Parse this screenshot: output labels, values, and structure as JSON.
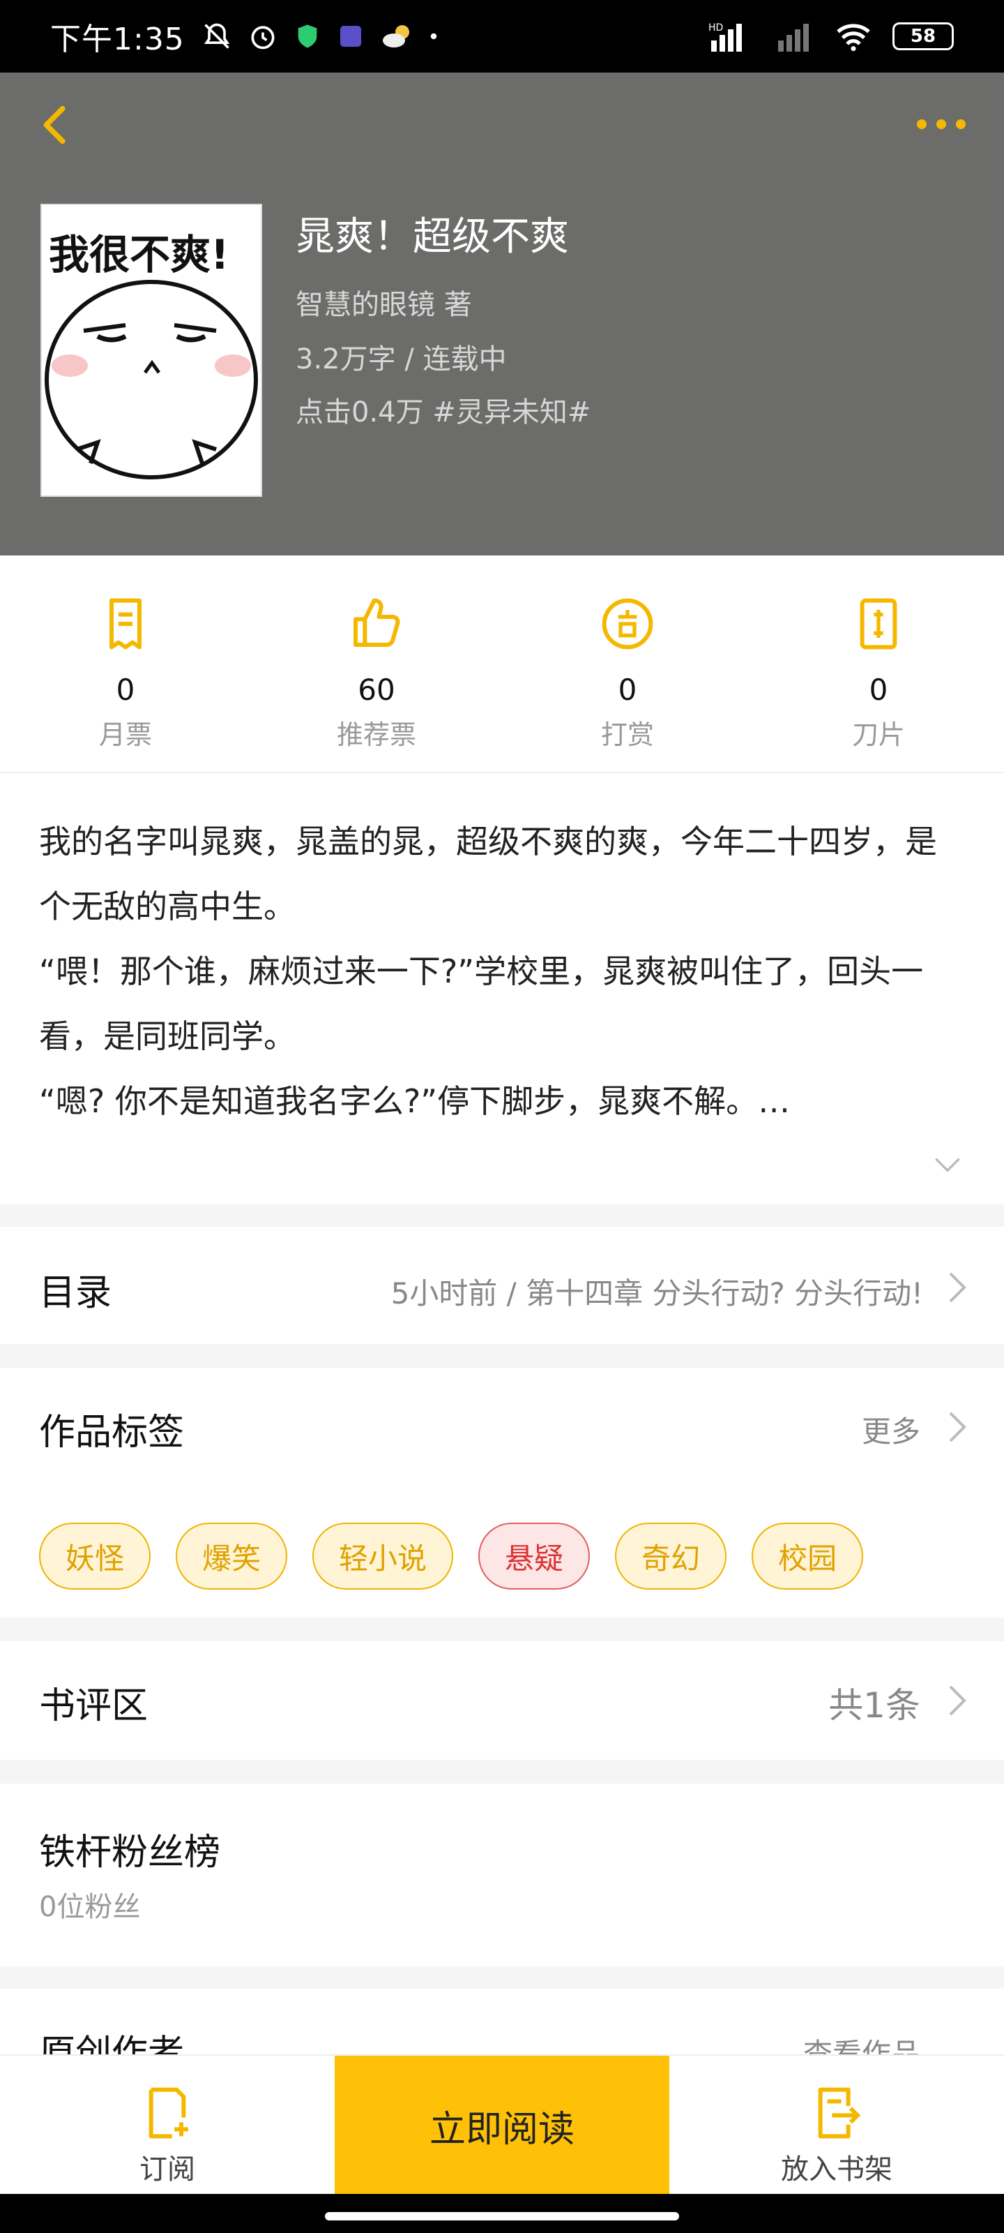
{
  "status_bar": {
    "time": "下午1:35",
    "battery": "58",
    "network_label": "HD"
  },
  "header": {
    "accent_color": "#f5b800"
  },
  "book": {
    "cover_text": "我很不爽!",
    "title": "晁爽！超级不爽",
    "author": "智慧的眼镜  著",
    "words_status": "3.2万字 / 连载中",
    "clicks_tag": "点击0.4万  #灵异未知#"
  },
  "stats": [
    {
      "icon": "monthly-ticket-icon",
      "value": "0",
      "label": "月票"
    },
    {
      "icon": "thumbs-up-icon",
      "value": "60",
      "label": "推荐票"
    },
    {
      "icon": "reward-icon",
      "value": "0",
      "label": "打赏"
    },
    {
      "icon": "blade-card-icon",
      "value": "0",
      "label": "刀片"
    }
  ],
  "intro": {
    "paragraphs": [
      "我的名字叫晁爽，晁盖的晁，超级不爽的爽，今年二十四岁，是个无敌的高中生。",
      "“喂！那个谁，麻烦过来一下?”学校里，晁爽被叫住了，回头一看，是同班同学。",
      "“嗯? 你不是知道我名字么?”停下脚步，晁爽不解。…"
    ]
  },
  "catalog": {
    "title": "目录",
    "latest": "5小时前 / 第十四章 分头行动? 分头行动!"
  },
  "tags_section": {
    "title": "作品标签",
    "more": "更多",
    "tags": [
      {
        "label": "妖怪",
        "style": "yellow"
      },
      {
        "label": "爆笑",
        "style": "yellow"
      },
      {
        "label": "轻小说",
        "style": "yellow"
      },
      {
        "label": "悬疑",
        "style": "red"
      },
      {
        "label": "奇幻",
        "style": "yellow"
      },
      {
        "label": "校园",
        "style": "yellow"
      }
    ]
  },
  "reviews": {
    "title": "书评区",
    "count": "共1条"
  },
  "fans": {
    "title": "铁杆粉丝榜",
    "count": "0位粉丝"
  },
  "author_section": {
    "title": "原创作者",
    "link": "查看作品"
  },
  "bottom_bar": {
    "subscribe": "订阅",
    "read_now": "立即阅读",
    "add_shelf": "放入书架"
  }
}
